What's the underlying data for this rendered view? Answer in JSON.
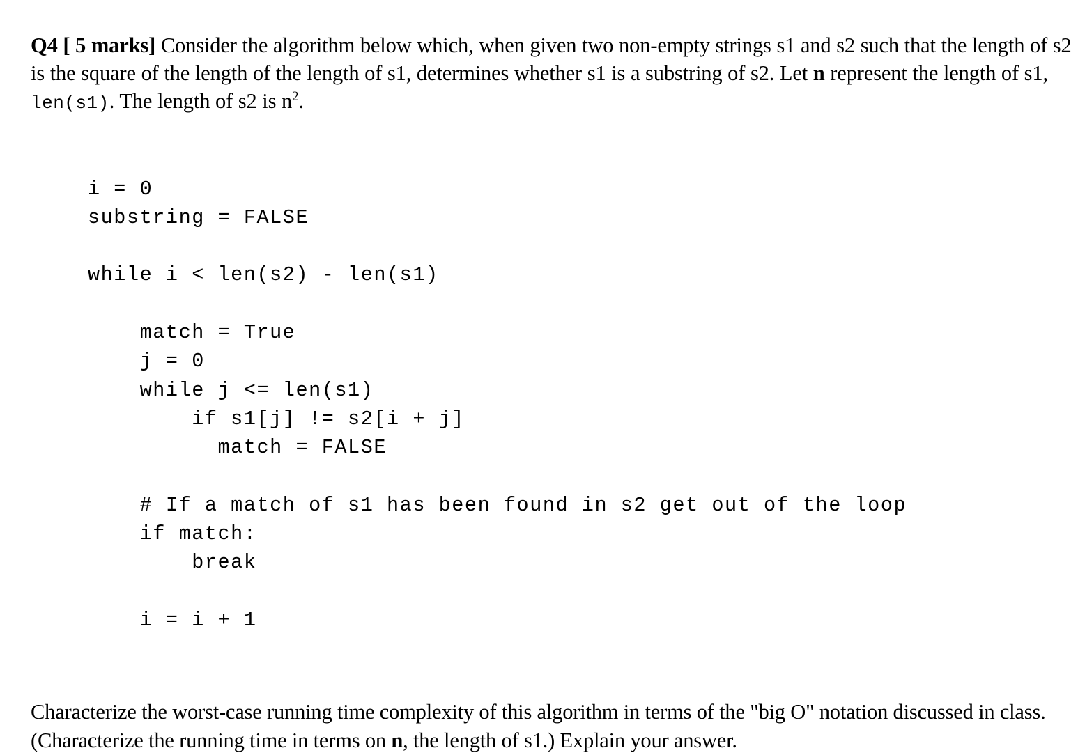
{
  "document": {
    "question": {
      "label": "Q4",
      "marks": "[ 5 marks]",
      "body_part1": "Consider the algorithm below which, when given two non-empty strings s1 and s2 such that the length of s2 is the square of the length of the length of s1, determines whether s1 is a substring of s2. Let ",
      "bold_n": "n",
      "body_part2": " represent the length of s1, ",
      "mono_call": "len(s1)",
      "body_part3": ". The length of s2 is n",
      "superscript": "2",
      "body_part4": "."
    },
    "code": {
      "language": "python-pseudocode",
      "lines": [
        "i = 0",
        "substring = FALSE",
        "",
        "while i < len(s2) - len(s1)",
        "",
        "    match = True",
        "    j = 0",
        "    while j <= len(s1)",
        "        if s1[j] != s2[i + j]",
        "          match = FALSE",
        "",
        "    # If a match of s1 has been found in s2 get out of the loop",
        "    if match:",
        "        break",
        "",
        "    i = i + 1"
      ]
    },
    "closing": {
      "part1": "Characterize the worst-case running time complexity of this algorithm in terms of the \"big O\" notation discussed in class. (Characterize the running time in terms on ",
      "bold_n": "n",
      "part2": ", the length of s1.) Explain your answer."
    },
    "colors": {
      "background": "#ffffff",
      "text": "#000000"
    }
  }
}
